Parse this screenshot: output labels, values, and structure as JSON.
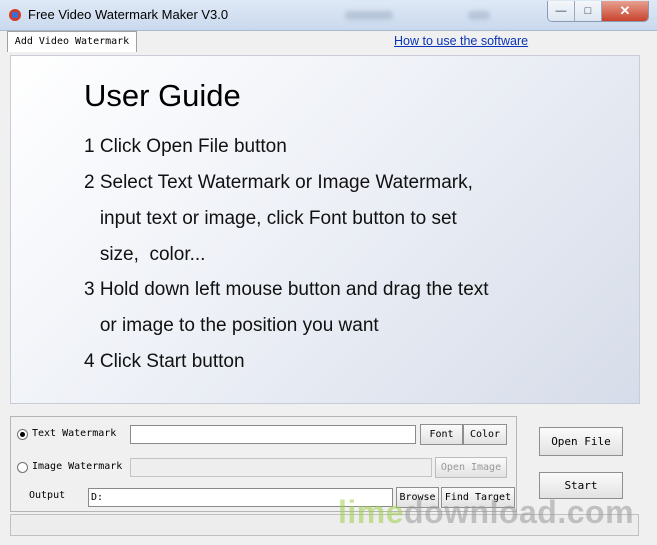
{
  "window": {
    "title": "Free Video Watermark Maker V3.0"
  },
  "tabs": [
    {
      "label": "Add Video Watermark"
    }
  ],
  "help_link": "How to use the software",
  "guide": {
    "title": "User Guide",
    "lines": [
      "1 Click Open File button",
      "2 Select Text Watermark or Image Watermark,",
      "   input text or image, click Font button to set",
      "   size,  color...",
      "3 Hold down left mouse button and drag the text",
      "   or image to the position you want",
      "4 Click Start button"
    ]
  },
  "controls": {
    "text_watermark": {
      "label": "Text Watermark",
      "selected": true,
      "value": ""
    },
    "image_watermark": {
      "label": "Image Watermark",
      "selected": false,
      "value": ""
    },
    "font_button": "Font",
    "color_button": "Color",
    "open_image_button": "Open Image",
    "output": {
      "label": "Output",
      "value": "D:"
    },
    "browse_button": "Browse",
    "find_target_button": "Find Target",
    "open_file_button": "Open File",
    "start_button": "Start"
  },
  "watermark": {
    "part1": "lime",
    "part2": "download.com"
  }
}
